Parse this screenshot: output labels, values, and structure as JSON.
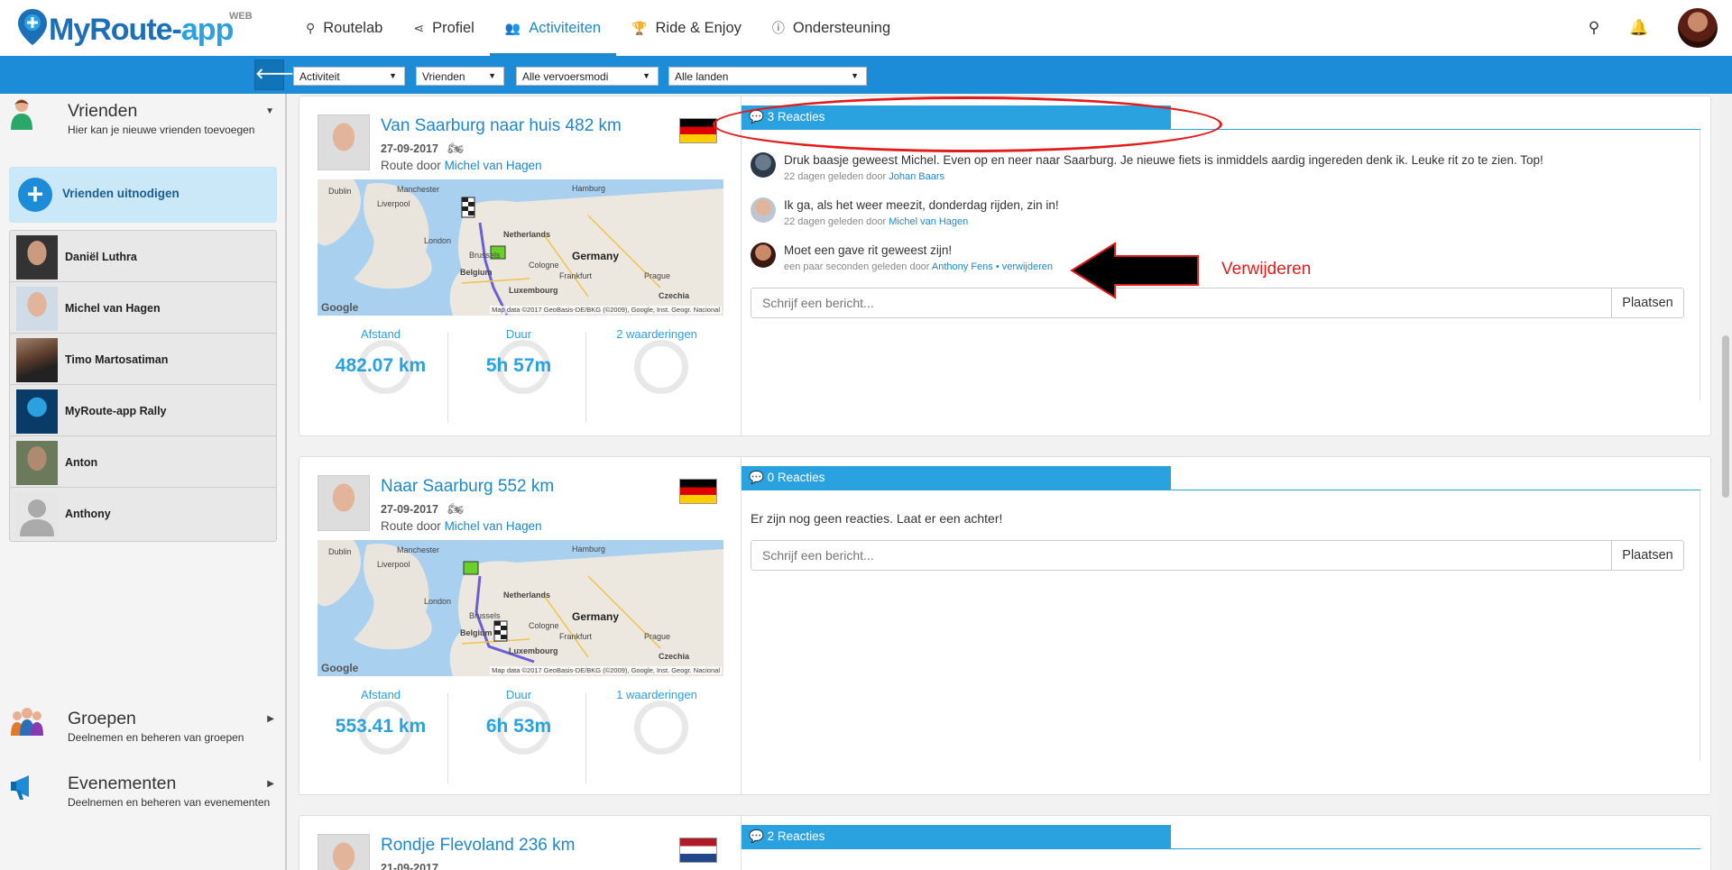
{
  "logo": {
    "text_main": "MyRoute-",
    "text_app": "app",
    "tag": "WEB"
  },
  "nav": [
    {
      "icon": "map-marker-icon",
      "glyph": "⚲",
      "label": "Routelab",
      "active": false
    },
    {
      "icon": "share-icon",
      "glyph": "⋖",
      "label": "Profiel",
      "active": false
    },
    {
      "icon": "users-icon",
      "glyph": "👥",
      "label": "Activiteiten",
      "active": true
    },
    {
      "icon": "trophy-icon",
      "glyph": "🏆",
      "label": "Ride & Enjoy",
      "active": false
    },
    {
      "icon": "info-icon",
      "glyph": "ⓘ",
      "label": "Ondersteuning",
      "active": false
    }
  ],
  "topicons": {
    "search": "⚲",
    "bell": "🔔"
  },
  "filters": {
    "back": "🡐",
    "activity": "Activiteit",
    "friends": "Vrienden",
    "transport": "Alle vervoersmodi",
    "countries": "Alle landen"
  },
  "sidebar": {
    "friends_section": {
      "title": "Vrienden",
      "subtitle": "Hier kan je nieuwe vrienden toevoegen"
    },
    "invite_label": "Vrienden uitnodigen",
    "friends": [
      {
        "name": "Daniël Luthra"
      },
      {
        "name": "Michel van Hagen"
      },
      {
        "name": "Timo Martosatiman"
      },
      {
        "name": "MyRoute-app Rally"
      },
      {
        "name": "Anton"
      },
      {
        "name": "Anthony"
      }
    ],
    "groups_section": {
      "title": "Groepen",
      "subtitle": "Deelnemen en beheren van groepen"
    },
    "events_section": {
      "title": "Evenementen",
      "subtitle": "Deelnemen en beheren van evenementen"
    }
  },
  "activities": [
    {
      "title": "Van Saarburg naar huis 482 km",
      "date": "27-09-2017",
      "route_by_prefix": "Route door",
      "route_by": "Michel van Hagen",
      "flag": "de",
      "map": {
        "labels": [
          "Dublin",
          "Liverpool",
          "Manchester",
          "London",
          "Brussels",
          "Belgium",
          "Netherlands",
          "Hamburg",
          "Cologne",
          "Frankfurt",
          "Prague",
          "Czechia",
          "Luxembourg"
        ],
        "country": "Germany",
        "google": "Google",
        "copyright": "Map data ©2017 GeoBasis-DE/BKG (©2009), Google, Inst. Geogr. Nacional"
      },
      "stats": {
        "distance_label": "Afstand",
        "distance": "482.07 km",
        "duration_label": "Duur",
        "duration": "5h 57m",
        "ratings_label": "2 waarderingen"
      },
      "reactions_label": "3 Reacties",
      "comments": [
        {
          "text": "Druk baasje geweest Michel. Even op en neer naar Saarburg. Je nieuwe fiets is inmiddels aardig ingereden denk ik. Leuke rit zo te zien. Top!",
          "meta": "22 dagen geleden door",
          "author": "Johan Baars"
        },
        {
          "text": "Ik ga, als het weer meezit, donderdag rijden, zin in!",
          "meta": "22 dagen geleden door",
          "author": "Michel van Hagen"
        },
        {
          "text": "Moet een gave rit geweest zijn!",
          "meta": "een paar seconden geleden door",
          "author": "Anthony Fens",
          "delete": "• verwijderen"
        }
      ],
      "input_placeholder": "Schrijf een bericht...",
      "post_label": "Plaatsen"
    },
    {
      "title": "Naar Saarburg 552 km",
      "date": "27-09-2017",
      "route_by_prefix": "Route door",
      "route_by": "Michel van Hagen",
      "flag": "de",
      "map": {
        "labels": [
          "Dublin",
          "Liverpool",
          "Manchester",
          "London",
          "Brussels",
          "Belgium",
          "Netherlands",
          "Hamburg",
          "Cologne",
          "Frankfurt",
          "Prague",
          "Czechia",
          "Luxembourg"
        ],
        "country": "Germany",
        "google": "Google",
        "copyright": "Map data ©2017 GeoBasis-DE/BKG (©2009), Google, Inst. Geogr. Nacional"
      },
      "stats": {
        "distance_label": "Afstand",
        "distance": "553.41 km",
        "duration_label": "Duur",
        "duration": "6h 53m",
        "ratings_label": "1 waarderingen"
      },
      "reactions_label": "0 Reacties",
      "no_reactions": "Er zijn nog geen reacties. Laat er een achter!",
      "input_placeholder": "Schrijf een bericht...",
      "post_label": "Plaatsen"
    },
    {
      "title": "Rondje Flevoland 236 km",
      "date": "21-09-2017",
      "flag": "nl",
      "reactions_label": "2 Reacties"
    }
  ],
  "annotation": {
    "label": "Verwijderen",
    "color": "#e21b1b"
  },
  "colors": {
    "brand_blue": "#1c8bd8",
    "accent": "#2aa2e0",
    "link": "#1e88c9",
    "annotation_red": "#e21b1b"
  }
}
